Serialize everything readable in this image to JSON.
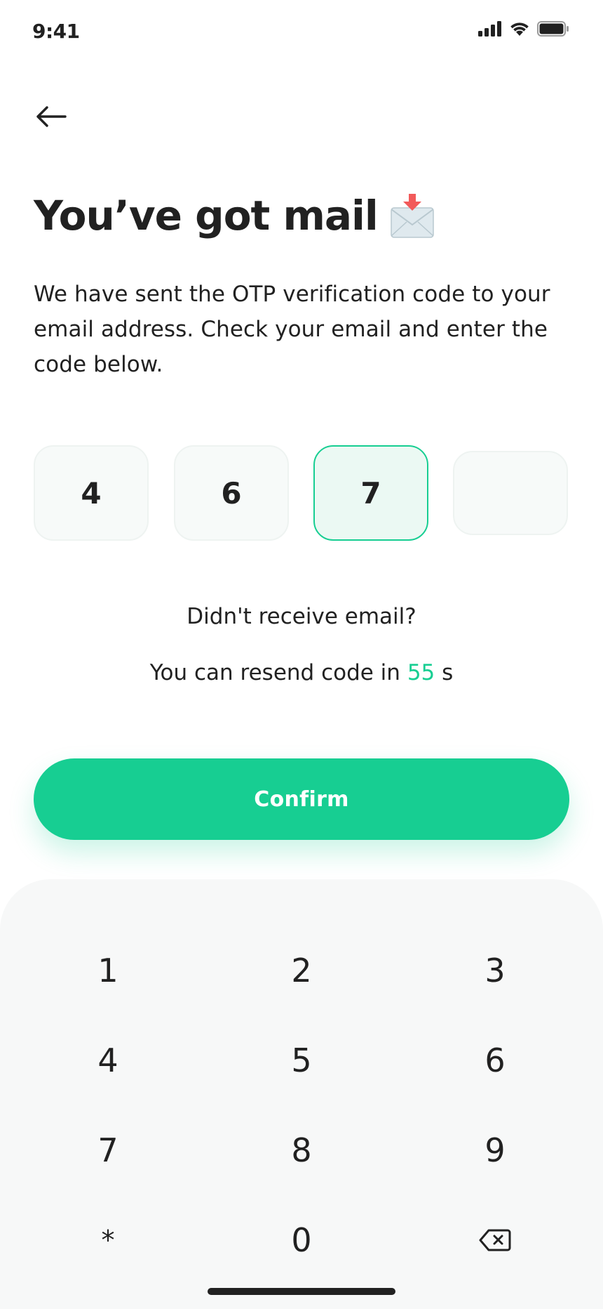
{
  "status_bar": {
    "time": "9:41",
    "icons": [
      "signal-icon",
      "wifi-icon",
      "battery-icon"
    ]
  },
  "header": {
    "back_icon": "arrow-left-icon"
  },
  "title": {
    "text": "You’ve got mail",
    "icon": "incoming-envelope-icon"
  },
  "description": "We have sent the OTP verification code to your email address. Check your email and enter the code below.",
  "otp": {
    "digits": [
      "4",
      "6",
      "7",
      ""
    ],
    "focused_index": 2
  },
  "resend": {
    "question": "Didn't receive email?",
    "prefix": "You can resend code in ",
    "seconds": "55",
    "suffix": " s"
  },
  "confirm_button": {
    "label": "Confirm"
  },
  "keypad": {
    "keys": [
      "1",
      "2",
      "3",
      "4",
      "5",
      "6",
      "7",
      "8",
      "9",
      "*",
      "0",
      "backspace"
    ],
    "backspace_icon": "backspace-icon"
  },
  "colors": {
    "accent": "#17ce92",
    "text": "#212121",
    "otp_background": "#f7faf9",
    "otp_focused_background": "#ebf9f3",
    "keypad_background": "#f7f8f8"
  }
}
